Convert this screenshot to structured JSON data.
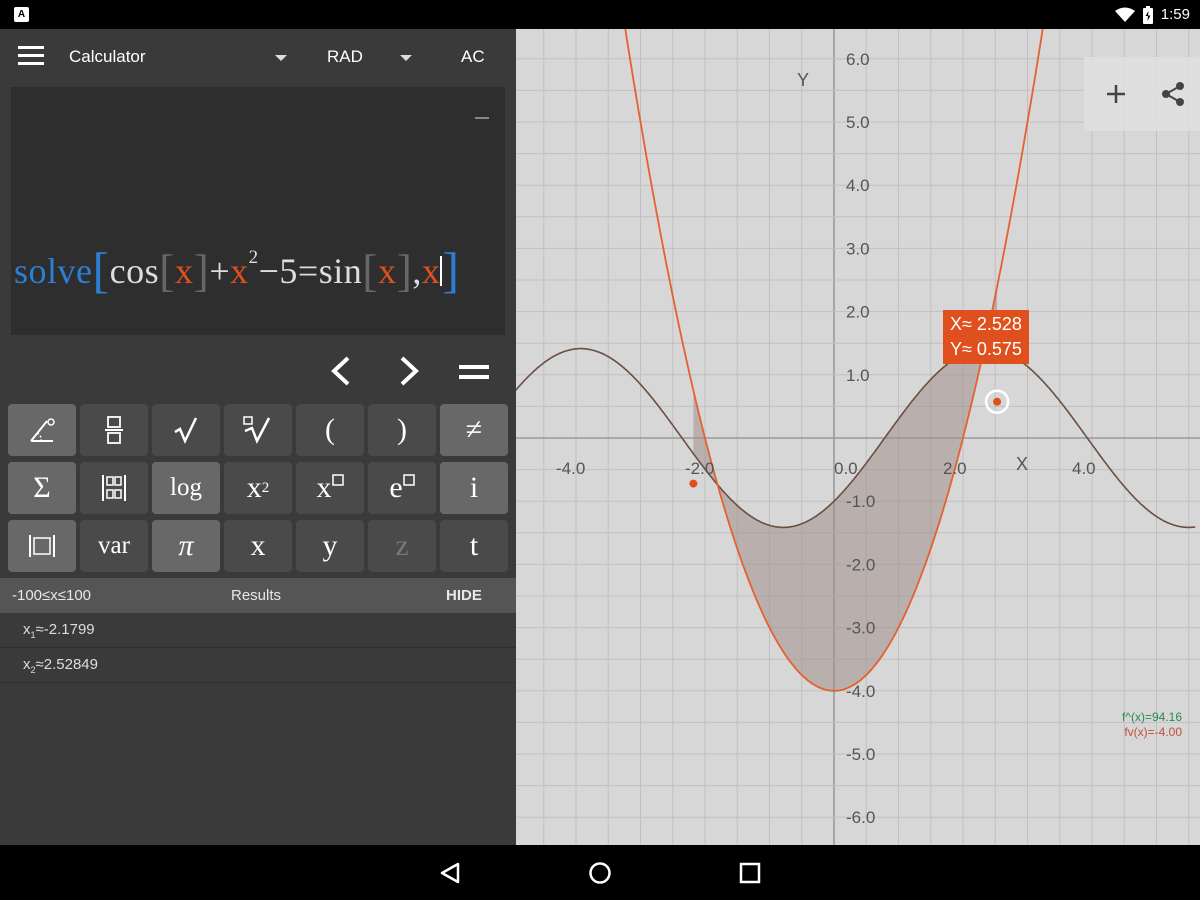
{
  "status_bar": {
    "time": "1:59",
    "app_icon_glyph": "A",
    "icons": [
      "wifi-icon",
      "battery-icon"
    ]
  },
  "toolbar": {
    "mode_label": "Calculator",
    "angle_label": "RAD",
    "clear_label": "AC"
  },
  "expression": {
    "func": "solve",
    "cos": "cos",
    "var": "x",
    "plus": "+",
    "exponent": "2",
    "minus_five_eq": "−5=",
    "sin": "sin",
    "comma": ","
  },
  "keypad": {
    "rows": [
      [
        "angle-key",
        "fraction-key",
        "sqrt-key",
        "nth-root-key",
        "(",
        ")",
        "≠"
      ],
      [
        "Σ",
        "matrix-key",
        "log",
        "x²",
        "x□",
        "e□",
        "i"
      ],
      [
        "abs-key",
        "var",
        "π",
        "x",
        "y",
        "z",
        "t"
      ]
    ],
    "labels": {
      "open_paren": "(",
      "close_paren": ")",
      "not_equal": "≠",
      "sigma": "Σ",
      "log": "log",
      "x_base": "x",
      "x_sq_exp": "2",
      "e_base": "e",
      "i": "i",
      "var": "var",
      "pi": "π",
      "x": "x",
      "y": "y",
      "z": "z",
      "t": "t"
    }
  },
  "results": {
    "range": "-100≤x≤100",
    "title": "Results",
    "hide_label": "HIDE",
    "items": [
      {
        "name": "x",
        "sub": "1",
        "value": "≈-2.1799"
      },
      {
        "name": "x",
        "sub": "2",
        "value": "≈2.52849"
      }
    ]
  },
  "graph": {
    "x_axis_label": "X",
    "y_axis_label": "Y",
    "x_ticks": [
      "-4.0",
      "-2.0",
      "0.0",
      "2.0",
      "4.0"
    ],
    "y_ticks": [
      "6.0",
      "5.0",
      "4.0",
      "3.0",
      "2.0",
      "1.0",
      "-1.0",
      "-2.0",
      "-3.0",
      "-4.0",
      "-5.0",
      "-6.0"
    ],
    "point": {
      "x_line": "X≈ 2.528",
      "y_line": "Y≈ 0.575"
    },
    "intersections": [
      [
        -2.1799,
        -0.7211
      ],
      [
        2.52849,
        0.5745
      ]
    ],
    "extrema": {
      "max": "f^(x)=94.16",
      "min": "fv(x)=-4.00"
    },
    "colors": {
      "parabola": "#e4612f",
      "sine": "#6b4f42",
      "shade": "#a0908a",
      "grid": "#c0c0c0",
      "axis": "#9a9a9a"
    }
  },
  "nav": {
    "icons": [
      "back-icon",
      "home-icon",
      "recents-icon"
    ]
  }
}
